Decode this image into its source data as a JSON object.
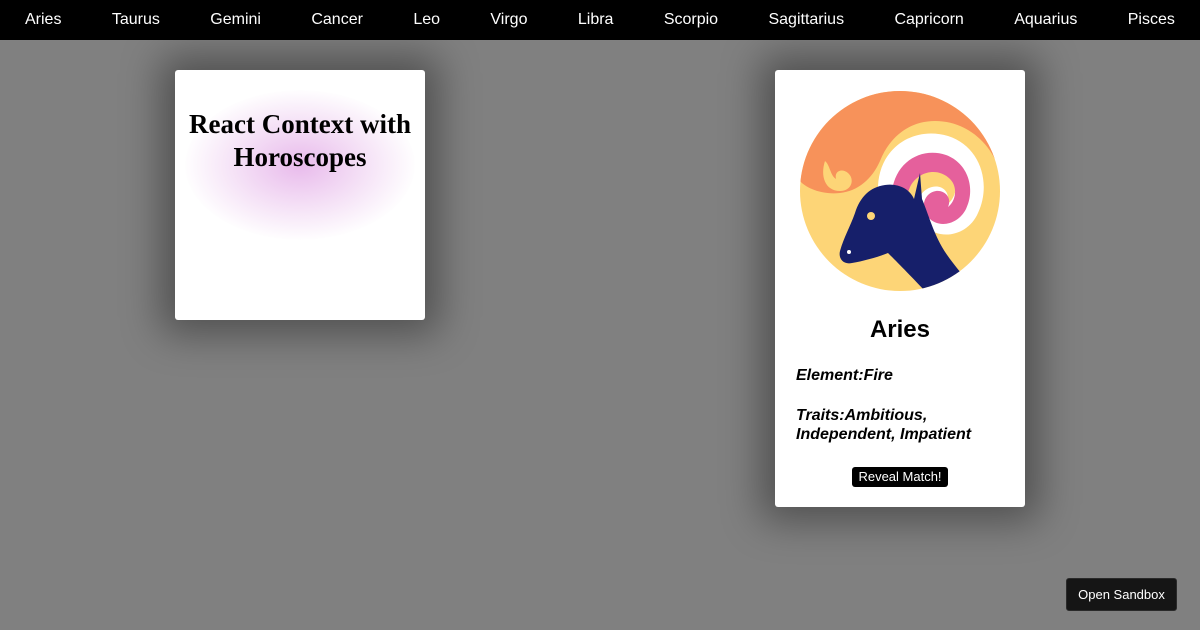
{
  "nav": {
    "items": [
      {
        "label": "Aries"
      },
      {
        "label": "Taurus"
      },
      {
        "label": "Gemini"
      },
      {
        "label": "Cancer"
      },
      {
        "label": "Leo"
      },
      {
        "label": "Virgo"
      },
      {
        "label": "Libra"
      },
      {
        "label": "Scorpio"
      },
      {
        "label": "Sagittarius"
      },
      {
        "label": "Capricorn"
      },
      {
        "label": "Aquarius"
      },
      {
        "label": "Pisces"
      }
    ]
  },
  "intro": {
    "title": "React Context with Horoscopes"
  },
  "sign": {
    "name": "Aries",
    "element_text": "Element:Fire",
    "traits_text": "Traits:Ambitious, Independent, Impatient",
    "reveal_label": "Reveal Match!",
    "icon": "aries-ram-icon",
    "colors": {
      "orange": "#F7925A",
      "yellow": "#FDD577",
      "pink": "#E5609C",
      "navy": "#161F6A",
      "white": "#FFFFFF"
    }
  },
  "sandbox": {
    "label": "Open Sandbox"
  },
  "theme": {
    "background": "#808080",
    "nav_background": "#000000",
    "card_background": "#FFFFFF"
  }
}
